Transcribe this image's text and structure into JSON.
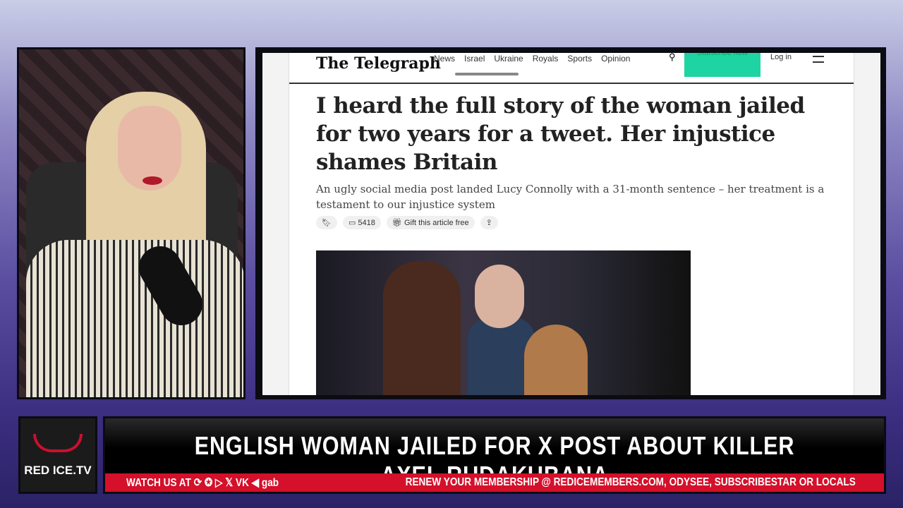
{
  "browser": {
    "logo": "The Telegraph",
    "nav": [
      "News",
      "Israel",
      "Ukraine",
      "Royals",
      "Sports",
      "Opinion"
    ],
    "subscribe": "Subscribe now",
    "login": "Log in"
  },
  "article": {
    "headline": "I heard the full story of the woman jailed for two years for a tweet. Her injustice shames Britain",
    "standfirst": "An ugly social media post landed Lucy Connolly with a 31-month sentence – her treatment is a testament to our injustice system",
    "comments": "5418",
    "gift": "Gift this article free"
  },
  "lower_third": {
    "channel": "RED ICE.TV",
    "headline": "ENGLISH WOMAN JAILED FOR X POST ABOUT KILLER AXEL RUDAKUBANA",
    "watch": "WATCH US AT ⟳ ✪ ▷ 𝕏 VK ◀ gab",
    "renew": "RENEW YOUR MEMBERSHIP @ REDICEMEMBERS.COM, ODYSEE, SUBSCRIBESTAR OR LOCALS"
  }
}
